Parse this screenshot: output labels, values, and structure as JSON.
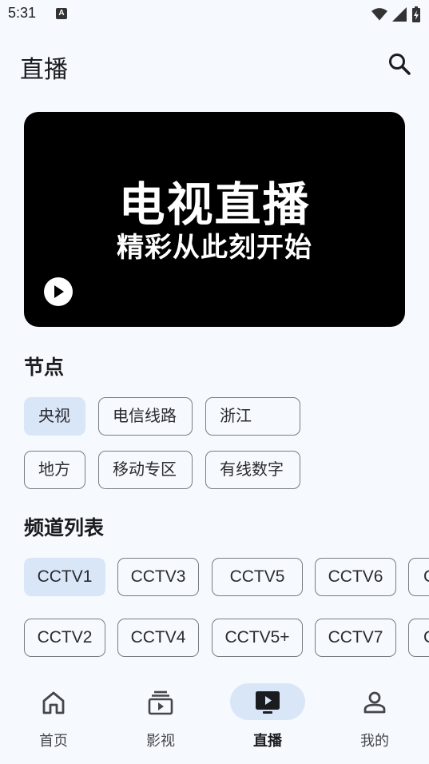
{
  "status_bar": {
    "time": "5:31",
    "notification_badge": "A"
  },
  "header": {
    "title": "直播"
  },
  "banner": {
    "title": "电视直播",
    "subtitle": "精彩从此刻开始"
  },
  "nodes_section": {
    "title": "节点",
    "chips": [
      "央视",
      "电信线路",
      "浙江",
      "地方",
      "移动专区",
      "有线数字"
    ],
    "selected": "央视"
  },
  "channels_section": {
    "title": "频道列表",
    "row1": [
      "CCTV1",
      "CCTV3",
      "CCTV5",
      "CCTV6",
      "C"
    ],
    "row2": [
      "CCTV2",
      "CCTV4",
      "CCTV5+",
      "CCTV7",
      "C"
    ],
    "selected": "CCTV1"
  },
  "bottom_nav": {
    "items": [
      {
        "label": "首页",
        "icon": "home-icon"
      },
      {
        "label": "影视",
        "icon": "video-library-icon"
      },
      {
        "label": "直播",
        "icon": "live-tv-icon"
      },
      {
        "label": "我的",
        "icon": "person-icon"
      }
    ],
    "active": "直播"
  },
  "colors": {
    "background": "#f6f9fd",
    "selected_chip": "#d9e6f8",
    "banner": "#000000"
  }
}
